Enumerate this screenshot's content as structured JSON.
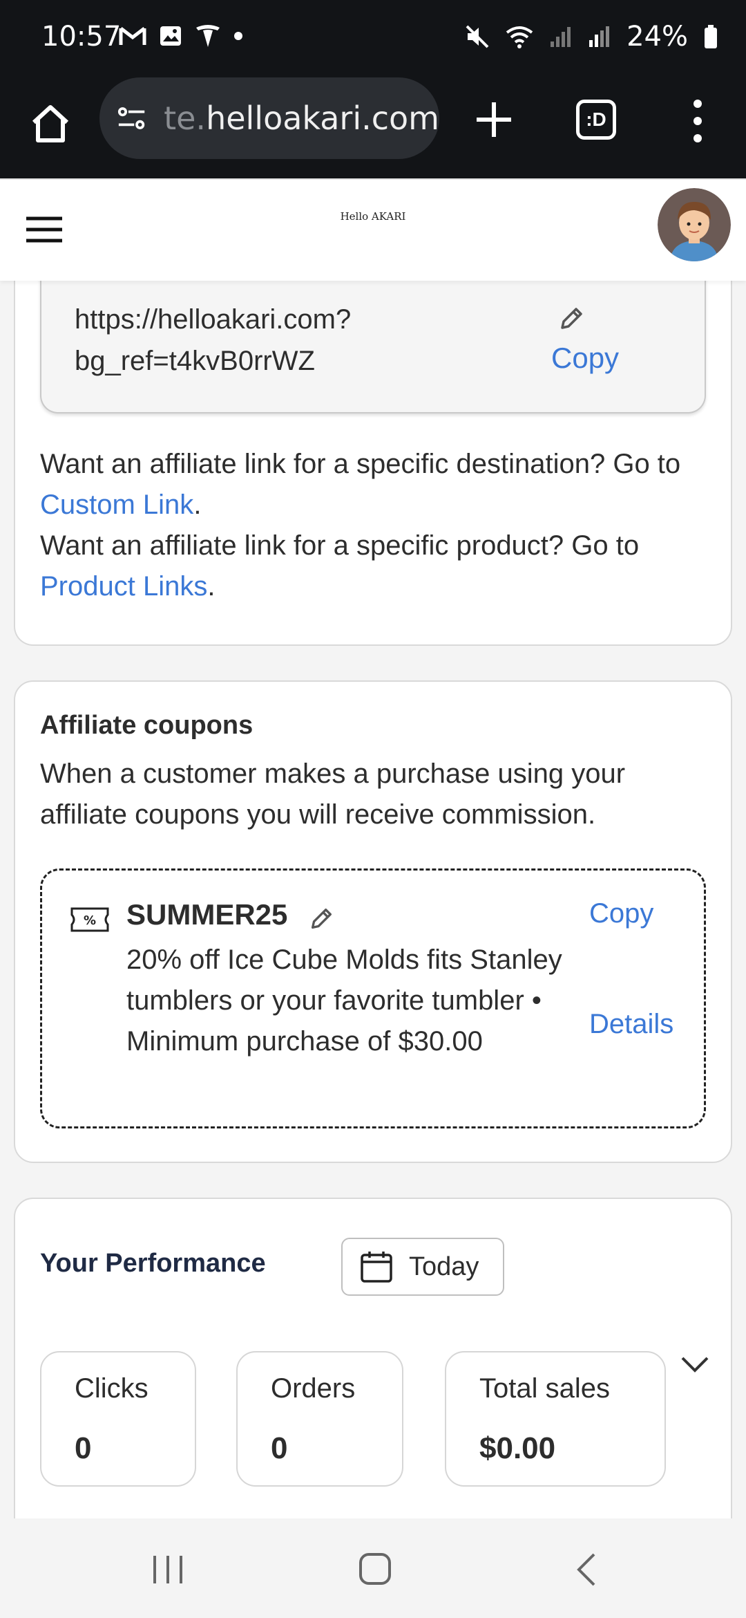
{
  "status_bar": {
    "time": "10:57",
    "battery": "24%"
  },
  "browser": {
    "url_faded": "te.",
    "url_main": "helloakari.com",
    "tabs_label": ":D"
  },
  "site_header": {
    "logo": "Hello AKARI"
  },
  "referral": {
    "url_line1": "https://helloakari.com?",
    "url_line2": "bg_ref=t4kvB0rrWZ",
    "copy_label": "Copy",
    "custom_prompt": "Want an affiliate link for a specific destination? Go to ",
    "custom_link": "Custom Link",
    "product_prompt": "Want an affiliate link for a specific product? Go to ",
    "product_link": "Product Links",
    "period": "."
  },
  "coupons": {
    "title": "Affiliate coupons",
    "description": "When a customer makes a purchase using your affiliate coupons you will receive commission.",
    "items": [
      {
        "code": "SUMMER25",
        "details": "20% off Ice Cube Molds fits Stanley tumblers or your favorite tumbler • Minimum purchase of $30.00",
        "copy_label": "Copy",
        "details_label": "Details"
      }
    ]
  },
  "performance": {
    "title": "Your Performance",
    "range_label": "Today",
    "stats": [
      {
        "label": "Clicks",
        "value": "0"
      },
      {
        "label": "Orders",
        "value": "0"
      },
      {
        "label": "Total sales",
        "value": "$0.00"
      }
    ]
  },
  "icons": {
    "home": "home-icon",
    "site_settings": "tune-icon",
    "new_tab": "plus-icon",
    "menu": "more-vert-icon",
    "hamburger": "hamburger-icon",
    "edit": "pencil-icon",
    "coupon": "ticket-percent-icon",
    "calendar": "calendar-icon",
    "expand": "chevron-down-icon"
  },
  "colors": {
    "link": "#3b78d6",
    "chrome_bg": "#121417",
    "title_navy": "#1f2a44"
  }
}
